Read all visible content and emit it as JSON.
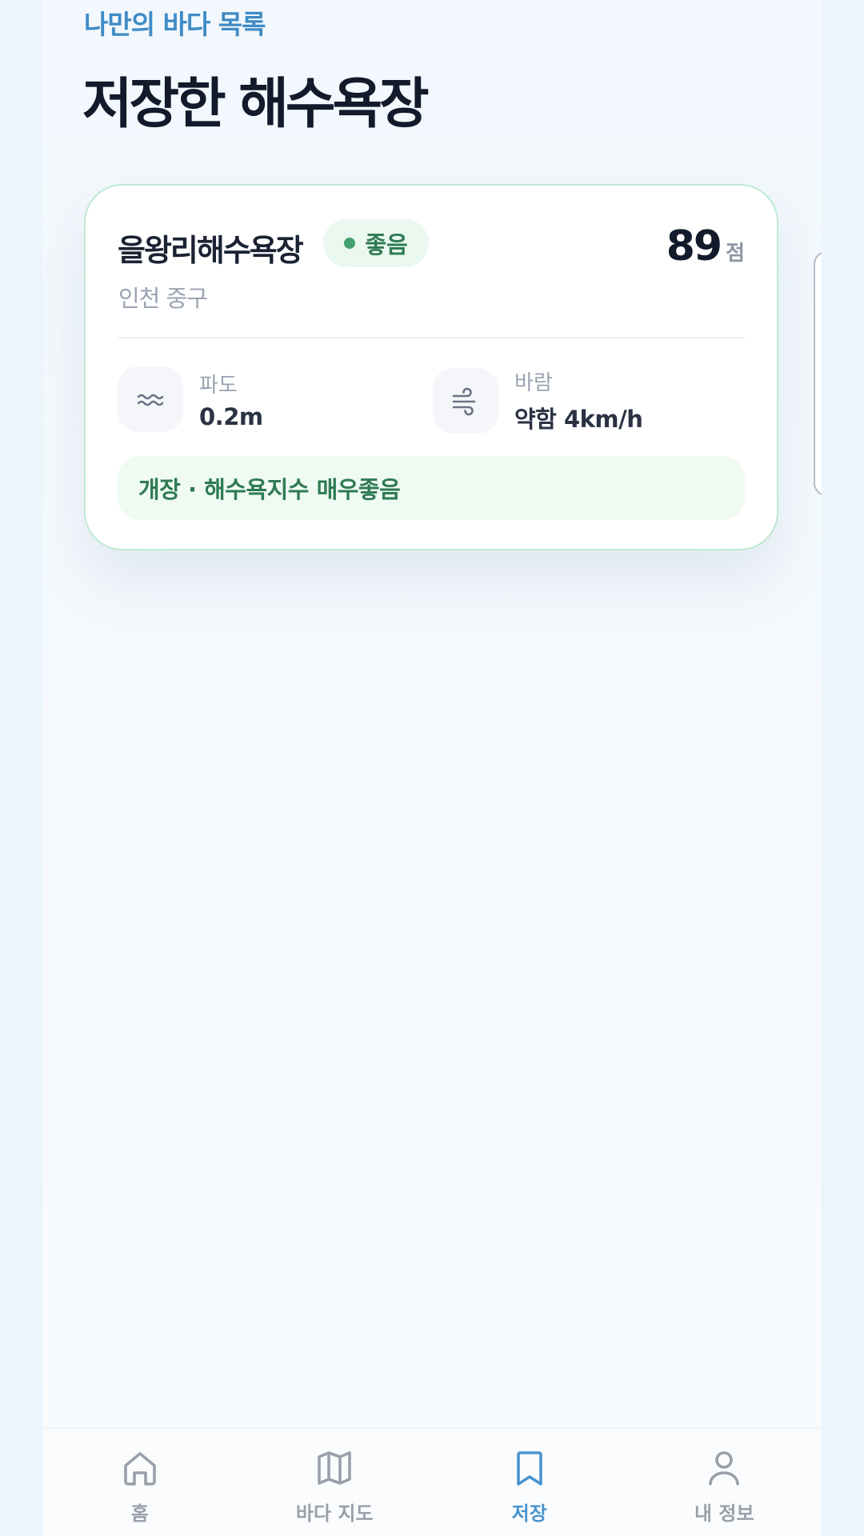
{
  "header": {
    "subtitle": "나만의 바다 목록",
    "title": "저장한 해수욕장"
  },
  "card": {
    "name": "을왕리해수욕장",
    "badge": "좋음",
    "region": "인천 중구",
    "score": "89",
    "score_unit": "점",
    "wave": {
      "label": "파도",
      "value": "0.2m",
      "icon": "wave-icon"
    },
    "wind": {
      "label": "바람",
      "value": "약함 4km/h",
      "icon": "wind-icon"
    },
    "status": "개장 · 해수욕지수 매우좋음"
  },
  "tabbar": {
    "tabs": [
      {
        "label": "홈",
        "icon": "home-icon",
        "active": false
      },
      {
        "label": "바다 지도",
        "icon": "map-icon",
        "active": false
      },
      {
        "label": "저장",
        "icon": "bookmark-icon",
        "active": true
      },
      {
        "label": "내 정보",
        "icon": "user-icon",
        "active": false
      }
    ]
  },
  "colors": {
    "accent": "#4a94cf",
    "good": "#2f7a52",
    "inactive": "#9aa0aa"
  }
}
